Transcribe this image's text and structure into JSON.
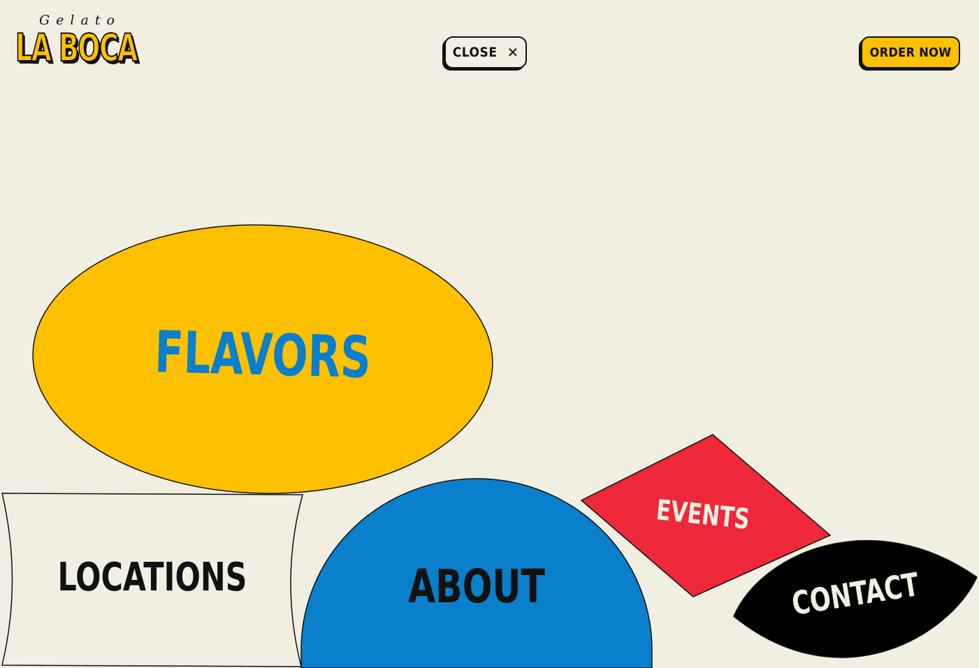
{
  "header": {
    "logo": {
      "script_text": "Gelato",
      "wordmark": "LA BOCA"
    },
    "close_button": {
      "label": "CLOSE",
      "icon": "close-icon"
    },
    "order_button": {
      "label": "ORDER NOW"
    }
  },
  "menu": {
    "items": [
      {
        "label": "FLAVORS",
        "fill": "#FFC000",
        "text_color": "#0A7FCC"
      },
      {
        "label": "LOCATIONS",
        "fill": "#F1EEE2",
        "text_color": "#111111"
      },
      {
        "label": "ABOUT",
        "fill": "#0A7FCC",
        "text_color": "#111111"
      },
      {
        "label": "EVENTS",
        "fill": "#EE2839",
        "text_color": "#F1EEE2"
      },
      {
        "label": "CONTACT",
        "fill": "#000000",
        "text_color": "#F1EEE2"
      }
    ]
  },
  "colors": {
    "background": "#F1EEE2",
    "yellow": "#FFC000",
    "blue": "#0A7FCC",
    "red": "#EE2839",
    "black": "#111111"
  }
}
